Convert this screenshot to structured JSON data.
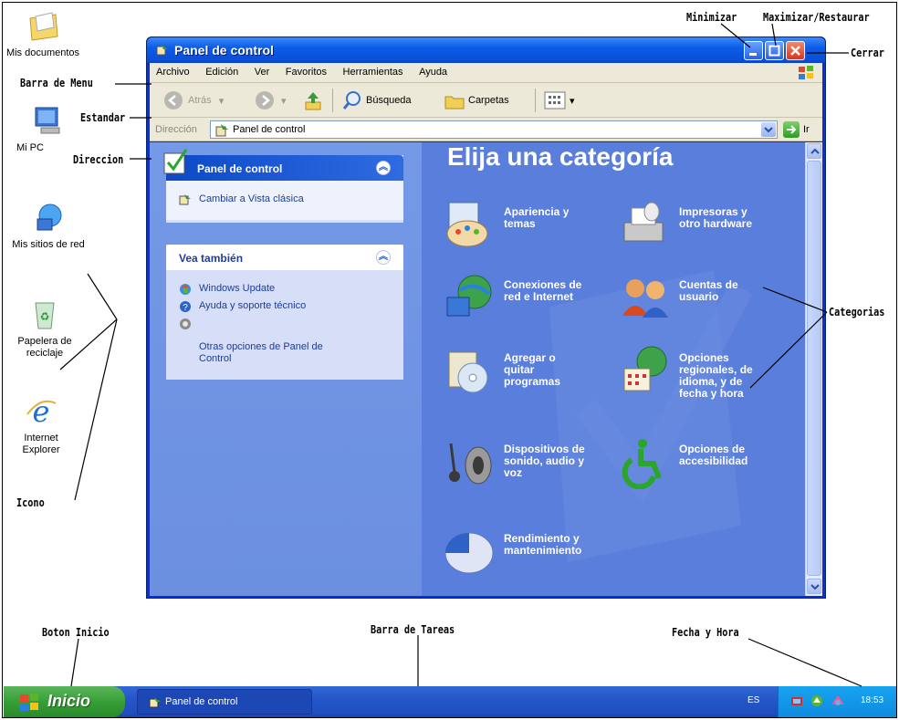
{
  "desktop": {
    "icons": [
      {
        "label": "Mis documentos"
      },
      {
        "label": "Mi PC"
      },
      {
        "label": "Mis sitios de red"
      },
      {
        "label": "Papelera de\nreciclaje"
      },
      {
        "label": "Internet\nExplorer"
      }
    ]
  },
  "annotations": {
    "minimizar": "Minimizar",
    "maximizar": "Maximizar/Restaurar",
    "cerrar": "Cerrar",
    "barra_menu": "Barra de Menu",
    "estandar": "Estandar",
    "direccion": "Direccion",
    "categorias": "Categorias",
    "icono": "Icono",
    "boton_inicio": "Boton Inicio",
    "barra_tareas": "Barra de Tareas",
    "fecha_hora": "Fecha y Hora"
  },
  "window": {
    "title": "Panel de control",
    "menu": [
      "Archivo",
      "Edición",
      "Ver",
      "Favoritos",
      "Herramientas",
      "Ayuda"
    ],
    "toolbar": {
      "back": "Atrás",
      "search": "Búsqueda",
      "folders": "Carpetas"
    },
    "address": {
      "label": "Dirección",
      "value": "Panel de control",
      "go": "Ir"
    },
    "left": {
      "panel1": {
        "title": "Panel de control",
        "links": [
          "Cambiar a Vista clásica"
        ]
      },
      "panel2": {
        "title": "Vea también",
        "links": [
          "Windows Update",
          "Ayuda y soporte técnico",
          "Otras opciones de Panel de\nControl"
        ]
      }
    },
    "heading": "Elija una categoría",
    "categories": [
      {
        "label": "Apariencia y\ntemas",
        "icon": "appearance-icon"
      },
      {
        "label": "Impresoras y\notro hardware",
        "icon": "printer-icon"
      },
      {
        "label": "Conexiones de\nred e Internet",
        "icon": "network-icon"
      },
      {
        "label": "Cuentas de\nusuario",
        "icon": "users-icon"
      },
      {
        "label": "Agregar o\nquitar\nprogramas",
        "icon": "add-remove-programs-icon"
      },
      {
        "label": "Opciones\nregionales, de\nidioma, y de\nfecha y hora",
        "icon": "regional-options-icon"
      },
      {
        "label": "Dispositivos de\nsonido, audio y\nvoz",
        "icon": "sound-icon"
      },
      {
        "label": "Opciones de\naccesibilidad",
        "icon": "accessibility-icon"
      },
      {
        "label": "Rendimiento y\nmantenimiento",
        "icon": "performance-icon"
      }
    ]
  },
  "taskbar": {
    "start": "Inicio",
    "task": "Panel de control",
    "lang": "ES",
    "clock": "18:53"
  }
}
